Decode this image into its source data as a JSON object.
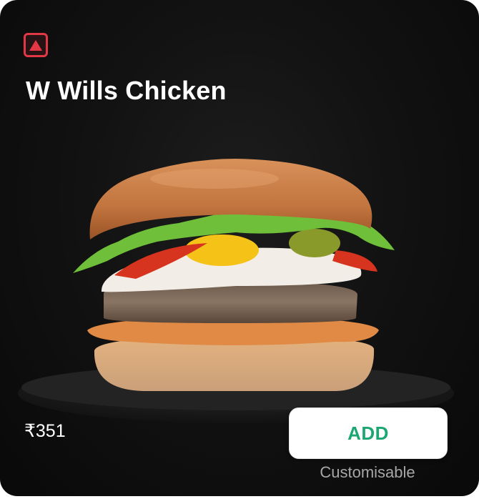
{
  "item": {
    "name": "W Wills Chicken",
    "price": "₹351",
    "add_label": "ADD",
    "customisable_note": "Customisable",
    "type_badge_icon": "non-veg-triangle-icon"
  },
  "colors": {
    "card_background": "#0d0d0d",
    "badge_red": "#e23744",
    "add_green": "#1ba672",
    "note_gray": "#a7a7a7"
  }
}
